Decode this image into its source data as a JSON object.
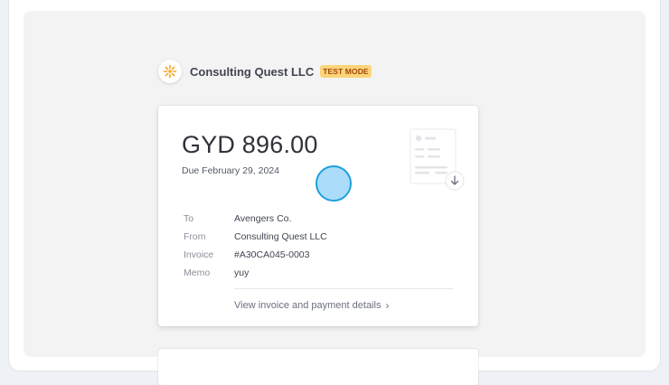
{
  "merchant": {
    "name": "Consulting Quest LLC",
    "badge": "TEST MODE",
    "logo_icon": "sun-burst-logo",
    "logo_color": "#f5a524"
  },
  "invoice": {
    "amount": "GYD 896.00",
    "due": "Due February 29, 2024",
    "illustration_icon": "invoice-download-icon",
    "details": [
      {
        "label": "To",
        "value": "Avengers Co."
      },
      {
        "label": "From",
        "value": "Consulting Quest LLC"
      },
      {
        "label": "Invoice",
        "value": "#A30CA045-0003"
      },
      {
        "label": "Memo",
        "value": "yuy"
      }
    ],
    "view_link": "View invoice and payment details",
    "view_link_chevron": "›"
  },
  "colors": {
    "badge_bg": "#fcd579",
    "badge_text": "#a2470c",
    "cursor_fill": "#87cefa",
    "cursor_stroke": "#1fa0dc"
  }
}
